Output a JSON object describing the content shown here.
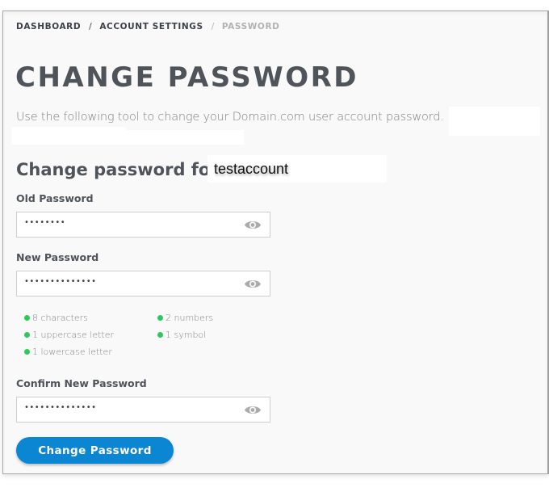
{
  "breadcrumb": {
    "items": [
      "DASHBOARD",
      "ACCOUNT SETTINGS"
    ],
    "current": "PASSWORD",
    "separator": "/"
  },
  "page": {
    "title": "CHANGE PASSWORD",
    "description": "Use the following tool to change your Domain.com user account password.",
    "subheading": "Change password for",
    "username": "testaccount"
  },
  "form": {
    "fields": [
      {
        "label": "Old Password",
        "masked_value": "••••••••",
        "toggle_icon": "eye-icon"
      },
      {
        "label": "New Password",
        "masked_value": "••••••••••••••",
        "toggle_icon": "eye-icon"
      },
      {
        "label": "Confirm New Password",
        "masked_value": "••••••••••••••",
        "toggle_icon": "eye-icon"
      }
    ],
    "requirements": [
      {
        "text": "8 characters",
        "met": true
      },
      {
        "text": "1 uppercase letter",
        "met": true
      },
      {
        "text": "1 lowercase letter",
        "met": true
      },
      {
        "text": "2 numbers",
        "met": true
      },
      {
        "text": "1 symbol",
        "met": true
      }
    ],
    "submit_label": "Change Password"
  },
  "colors": {
    "accent": "#0b86d2",
    "requirement_met": "#2ec95c",
    "heading": "#4e545a"
  }
}
